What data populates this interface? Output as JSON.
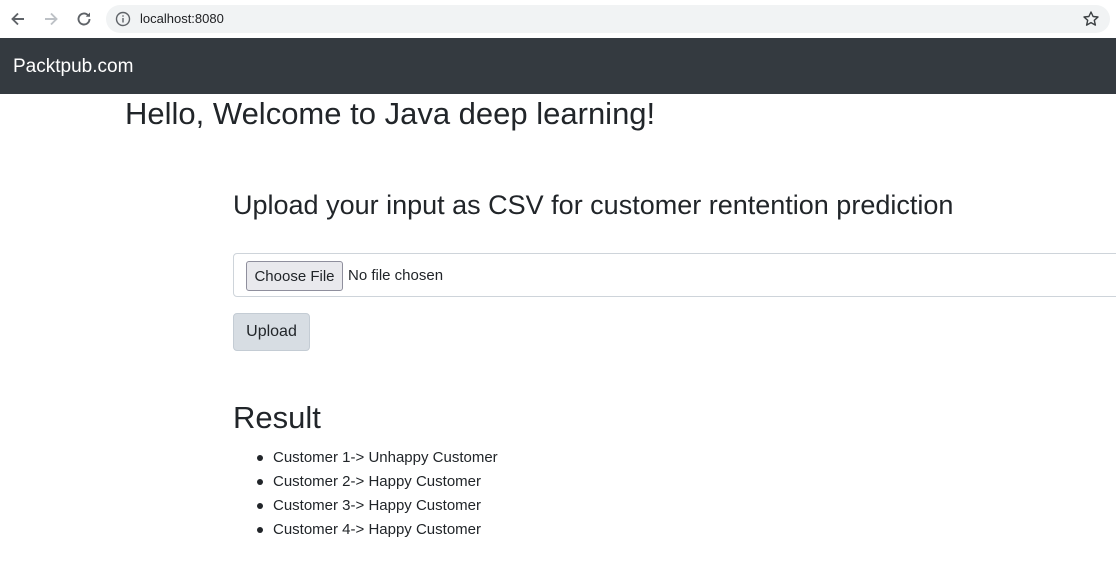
{
  "browser": {
    "url": "localhost:8080"
  },
  "navbar": {
    "brand": "Packtpub.com"
  },
  "main": {
    "welcome_title": "Hello, Welcome to Java deep learning!",
    "upload_heading": "Upload your input as CSV for customer rentention prediction",
    "file_input": {
      "button_label": "Choose File",
      "status_text": "No file chosen"
    },
    "upload_button_label": "Upload",
    "result_heading": "Result",
    "results": [
      "Customer 1-> Unhappy Customer",
      "Customer 2-> Happy Customer",
      "Customer 3-> Happy Customer",
      "Customer 4-> Happy Customer"
    ]
  },
  "colors": {
    "navbar_bg": "#343a40",
    "text": "#212529",
    "omnibox_bg": "#f1f3f4"
  }
}
